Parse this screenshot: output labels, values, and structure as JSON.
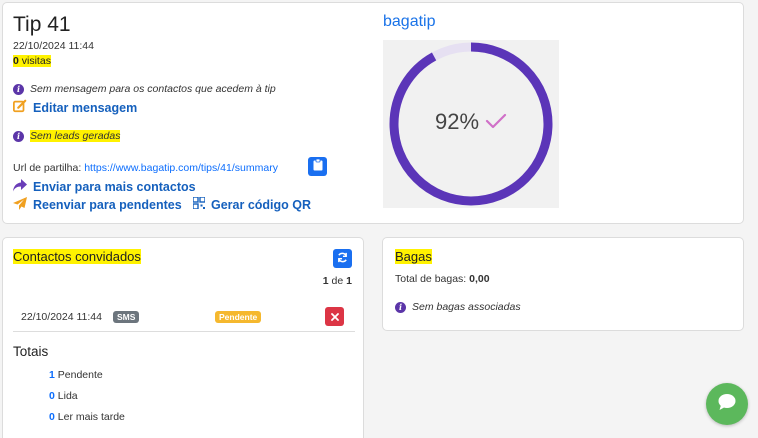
{
  "tip": {
    "title": "Tip 41",
    "datetime": "22/10/2024 11:44",
    "visits_count": "0",
    "visits_label": "visitas",
    "no_message_text": "Sem mensagem para os contactos que acedem à tip",
    "edit_message_label": "Editar mensagem",
    "no_leads_text": "Sem leads geradas",
    "share_label": "Url de partilha:",
    "share_url": "https://www.bagatip.com/tips/41/summary",
    "send_more_label": "Enviar para mais contactos",
    "resend_pending_label": "Reenviar para pendentes",
    "qr_label": "Gerar código QR"
  },
  "brand": {
    "name": "bagatip",
    "color": "#1a73e8"
  },
  "progress": {
    "percent_text": "92%",
    "value": 0.92,
    "ring_color": "#5b35b8",
    "check_color": "#d070c8"
  },
  "contacts": {
    "title": "Contactos convidados",
    "page_current": "1",
    "page_sep": "de",
    "page_total": "1",
    "rows": [
      {
        "datetime": "22/10/2024 11:44",
        "channel": "SMS",
        "status": "Pendente"
      }
    ],
    "totals_title": "Totais",
    "totals": [
      {
        "count": "1",
        "label": "Pendente"
      },
      {
        "count": "0",
        "label": "Lida"
      },
      {
        "count": "0",
        "label": "Ler mais tarde"
      }
    ]
  },
  "bagas": {
    "title": "Bagas",
    "total_label": "Total de bagas:",
    "total_value": "0,00",
    "empty_text": "Sem bagas associadas"
  },
  "colors": {
    "accent_blue": "#0d6efd",
    "refresh_button": "#1a6ff0",
    "delete_button": "#dc3545",
    "pending_badge": "#f5b82e",
    "sms_badge": "#6c757d",
    "chat_button": "#5cb85c",
    "highlight": "#fff200"
  },
  "icons": {
    "info": "info-circle",
    "edit": "pencil-square",
    "clipboard": "clipboard",
    "share": "share-arrow",
    "send": "paper-plane",
    "qr": "qrcode",
    "refresh": "sync",
    "delete": "times",
    "chat": "comment",
    "check": "check"
  }
}
